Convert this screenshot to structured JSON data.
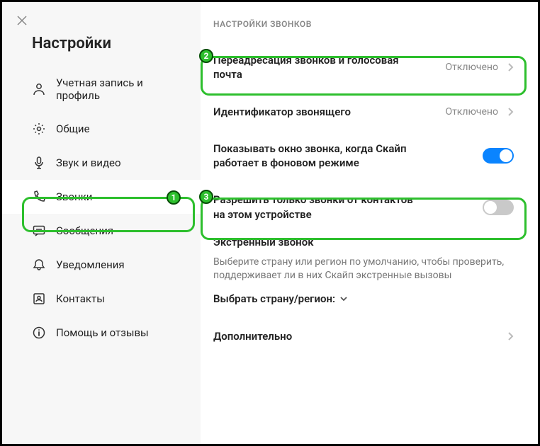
{
  "sidebar": {
    "title": "Настройки",
    "items": [
      {
        "label": "Учетная запись и профиль"
      },
      {
        "label": "Общие"
      },
      {
        "label": "Звук и видео"
      },
      {
        "label": "Звонки"
      },
      {
        "label": "Сообщения"
      },
      {
        "label": "Уведомления"
      },
      {
        "label": "Контакты"
      },
      {
        "label": "Помощь и отзывы"
      }
    ]
  },
  "content": {
    "section_title": "НАСТРОЙКИ ЗВОНКОВ",
    "forwarding": {
      "label": "Переадресация звонков и голосовая почта",
      "status": "Отключено"
    },
    "caller_id": {
      "label": "Идентификатор звонящего",
      "status": "Отключено"
    },
    "show_window": {
      "label": "Показывать окно звонка, когда Скайп работает в фоновом режиме"
    },
    "contacts_only": {
      "label": "Разрешить только звонки от контактов на этом устройстве"
    },
    "emergency": {
      "heading": "Экстренный звонок",
      "desc": "Выберите страну или регион по умолчанию, чтобы проверить, поддерживает ли в них Скайп экстренные вызовы",
      "picker": "Выбрать страну/регион:"
    },
    "advanced": {
      "label": "Дополнительно"
    }
  },
  "annotations": {
    "b1": "1",
    "b2": "2",
    "b3": "3"
  }
}
